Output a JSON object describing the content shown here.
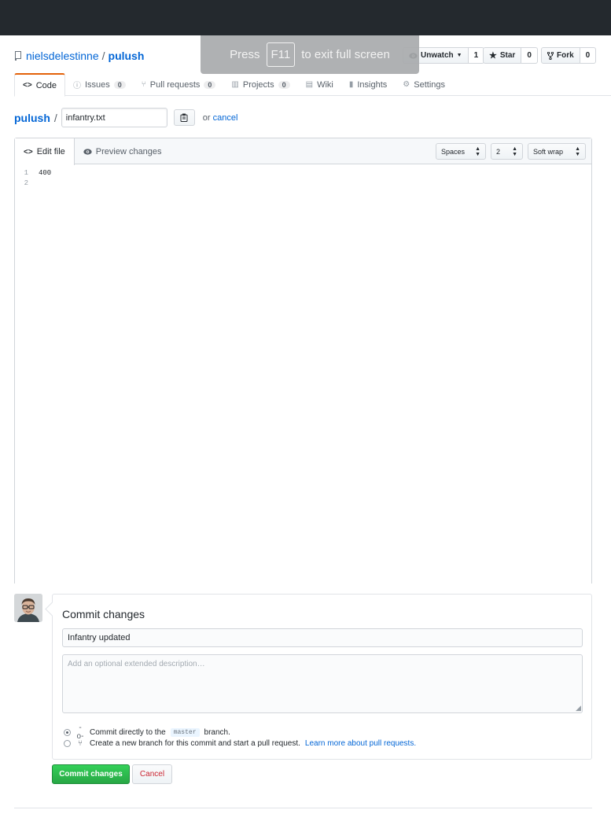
{
  "repo": {
    "owner": "nielsdelestinne",
    "separator": "/",
    "name": "pulush",
    "icon": "repo-icon"
  },
  "actions": {
    "watch": {
      "label": "Unwatch",
      "icon": "eye-icon",
      "count": "1"
    },
    "star": {
      "label": "Star",
      "icon": "star-icon",
      "count": "0"
    },
    "fork": {
      "label": "Fork",
      "icon": "repo-forked-icon",
      "count": "0"
    }
  },
  "fullscreen_overlay": {
    "prefix": "Press",
    "key": "F11",
    "suffix": "to exit full screen"
  },
  "tabs": [
    {
      "label": "Code",
      "icon": "code-icon",
      "selected": true
    },
    {
      "label": "Issues",
      "icon": "issue-opened-icon",
      "count": "0"
    },
    {
      "label": "Pull requests",
      "icon": "git-pull-request-icon",
      "count": "0"
    },
    {
      "label": "Projects",
      "icon": "project-icon",
      "count": "0"
    },
    {
      "label": "Wiki",
      "icon": "book-icon"
    },
    {
      "label": "Insights",
      "icon": "graph-icon"
    },
    {
      "label": "Settings",
      "icon": "gear-icon"
    }
  ],
  "path": {
    "repo": "pulush",
    "separator": "/",
    "filename": "infantry.txt",
    "or_text": "or",
    "cancel_link": "cancel"
  },
  "editor": {
    "tabs": [
      {
        "label": "Edit file",
        "icon": "code-icon",
        "selected": true
      },
      {
        "label": "Preview changes",
        "icon": "eye-icon"
      }
    ],
    "indent_mode": "Spaces",
    "indent_size": "2",
    "wrap_mode": "Soft wrap",
    "lines": [
      {
        "number": "1",
        "text": "400"
      },
      {
        "number": "2",
        "text": ""
      }
    ]
  },
  "commit": {
    "title": "Commit changes",
    "summary_value": "Infantry updated",
    "description_placeholder": "Add an optional extended description…",
    "option_direct": {
      "prefix": "Commit directly to the",
      "branch": "master",
      "suffix": "branch.",
      "checked": true
    },
    "option_new_branch": {
      "text_bold": "Create a new branch",
      "text_rest": "for this commit and start a pull request.",
      "link": "Learn more about pull requests.",
      "checked": false
    },
    "submit_label": "Commit changes",
    "cancel_label": "Cancel"
  },
  "colors": {
    "header_bg": "#24292e",
    "link": "#0366d6",
    "primary_button": "#28a745",
    "cancel_text": "#cb2431",
    "selected_tab_accent": "#e36209"
  }
}
